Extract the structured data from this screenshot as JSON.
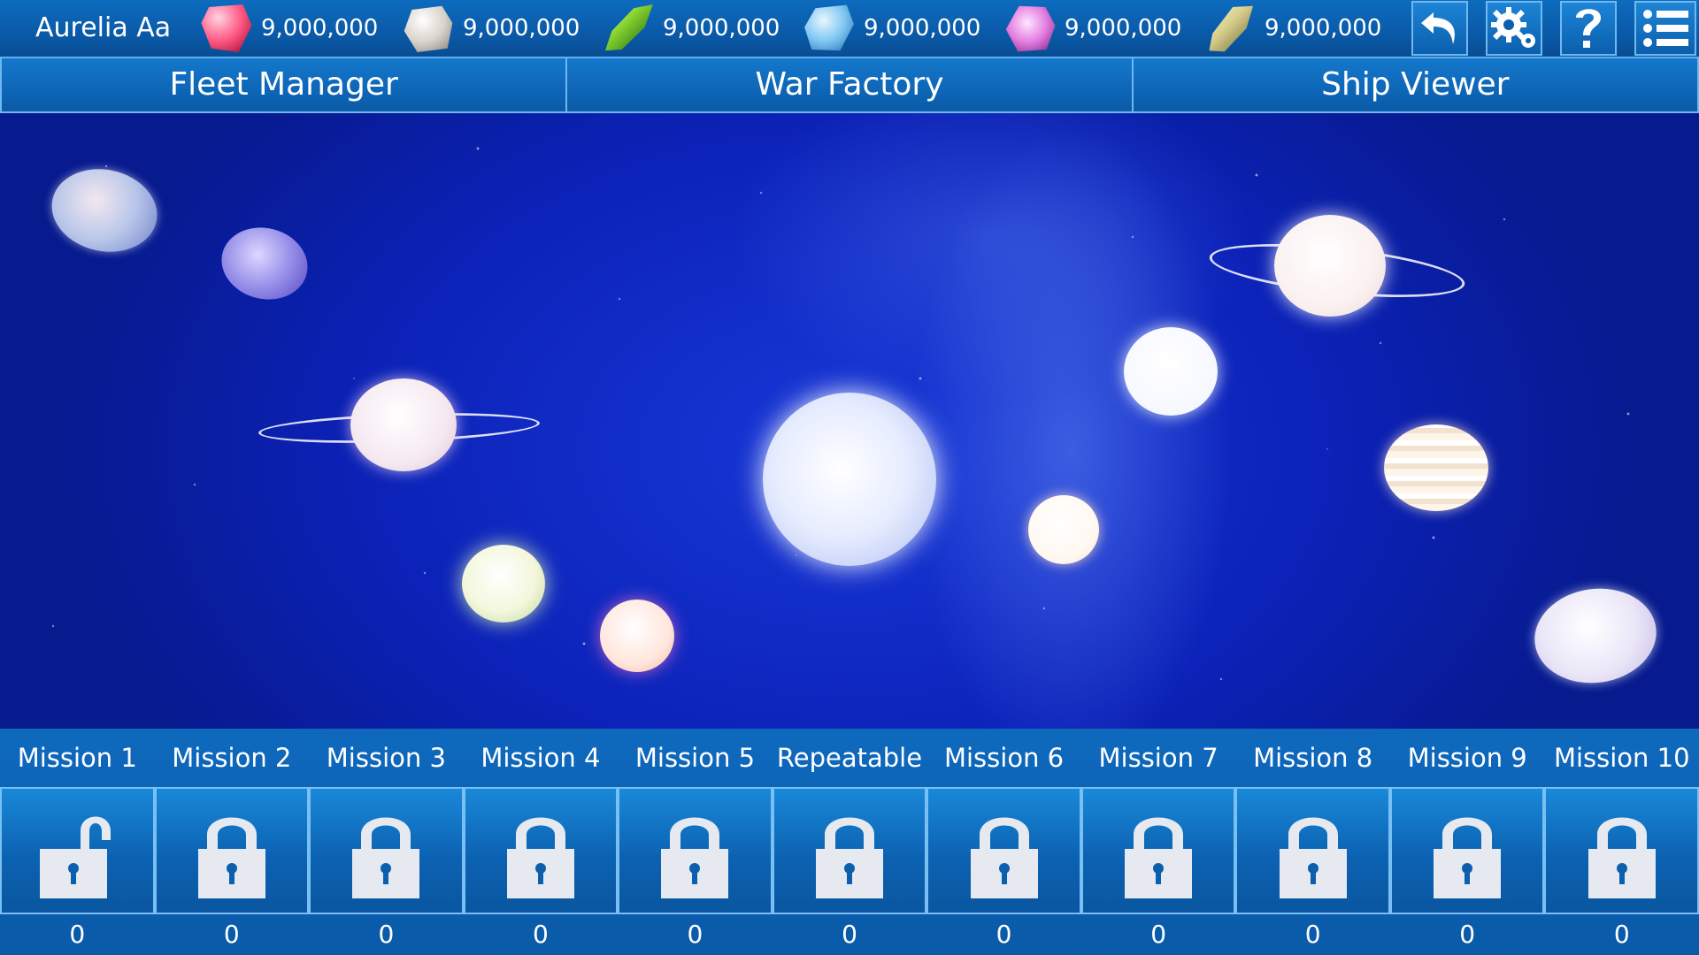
{
  "player": {
    "name": "Aurelia Aa"
  },
  "resources": [
    {
      "icon": "red-crystal-icon",
      "amount": "9,000,000"
    },
    {
      "icon": "white-crystal-icon",
      "amount": "9,000,000"
    },
    {
      "icon": "green-crystal-icon",
      "amount": "9,000,000"
    },
    {
      "icon": "blue-crystal-icon",
      "amount": "9,000,000"
    },
    {
      "icon": "pink-crystal-icon",
      "amount": "9,000,000"
    },
    {
      "icon": "gold-crystal-icon",
      "amount": "9,000,000"
    }
  ],
  "toolbar": {
    "undo_icon": "undo-icon",
    "settings_icon": "gear-icon",
    "help_icon": "help-icon",
    "menu_icon": "menu-icon"
  },
  "tabs": [
    {
      "label": "Fleet Manager"
    },
    {
      "label": "War Factory"
    },
    {
      "label": "Ship Viewer"
    }
  ],
  "missions": [
    {
      "label": "Mission 1",
      "count": "0",
      "locked": false
    },
    {
      "label": "Mission 2",
      "count": "0",
      "locked": true
    },
    {
      "label": "Mission 3",
      "count": "0",
      "locked": true
    },
    {
      "label": "Mission 4",
      "count": "0",
      "locked": true
    },
    {
      "label": "Mission 5",
      "count": "0",
      "locked": true
    },
    {
      "label": "Repeatable",
      "count": "0",
      "locked": true
    },
    {
      "label": "Mission 6",
      "count": "0",
      "locked": true
    },
    {
      "label": "Mission 7",
      "count": "0",
      "locked": true
    },
    {
      "label": "Mission 8",
      "count": "0",
      "locked": true
    },
    {
      "label": "Mission 9",
      "count": "0",
      "locked": true
    },
    {
      "label": "Mission 10",
      "count": "0",
      "locked": true
    }
  ],
  "colors": {
    "bar": "#0a5aa8",
    "border": "#6cb8f0",
    "space": "#0c22b8"
  }
}
